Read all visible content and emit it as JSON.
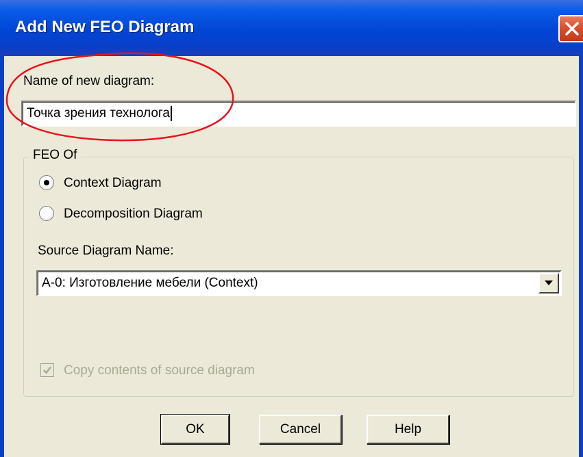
{
  "window": {
    "title": "Add New FEO Diagram"
  },
  "name_field": {
    "label": "Name of new diagram:",
    "value": "Точка зрения технолога"
  },
  "feo_group": {
    "legend": "FEO Of",
    "options": [
      {
        "label": "Context Diagram",
        "selected": true
      },
      {
        "label": "Decomposition Diagram",
        "selected": false
      }
    ],
    "source_label": "Source Diagram Name:",
    "source_value": "A-0:  Изготовление мебели (Context)",
    "copy_checkbox": {
      "label": "Copy contents of source diagram",
      "checked": true,
      "disabled": true
    }
  },
  "buttons": {
    "ok": "OK",
    "cancel": "Cancel",
    "help": "Help"
  },
  "annotation": {
    "color": "#e8131b"
  },
  "colors": {
    "titlebar": "#0046d5",
    "dialog_bg": "#ece9d8",
    "close_button": "#d9502e"
  }
}
